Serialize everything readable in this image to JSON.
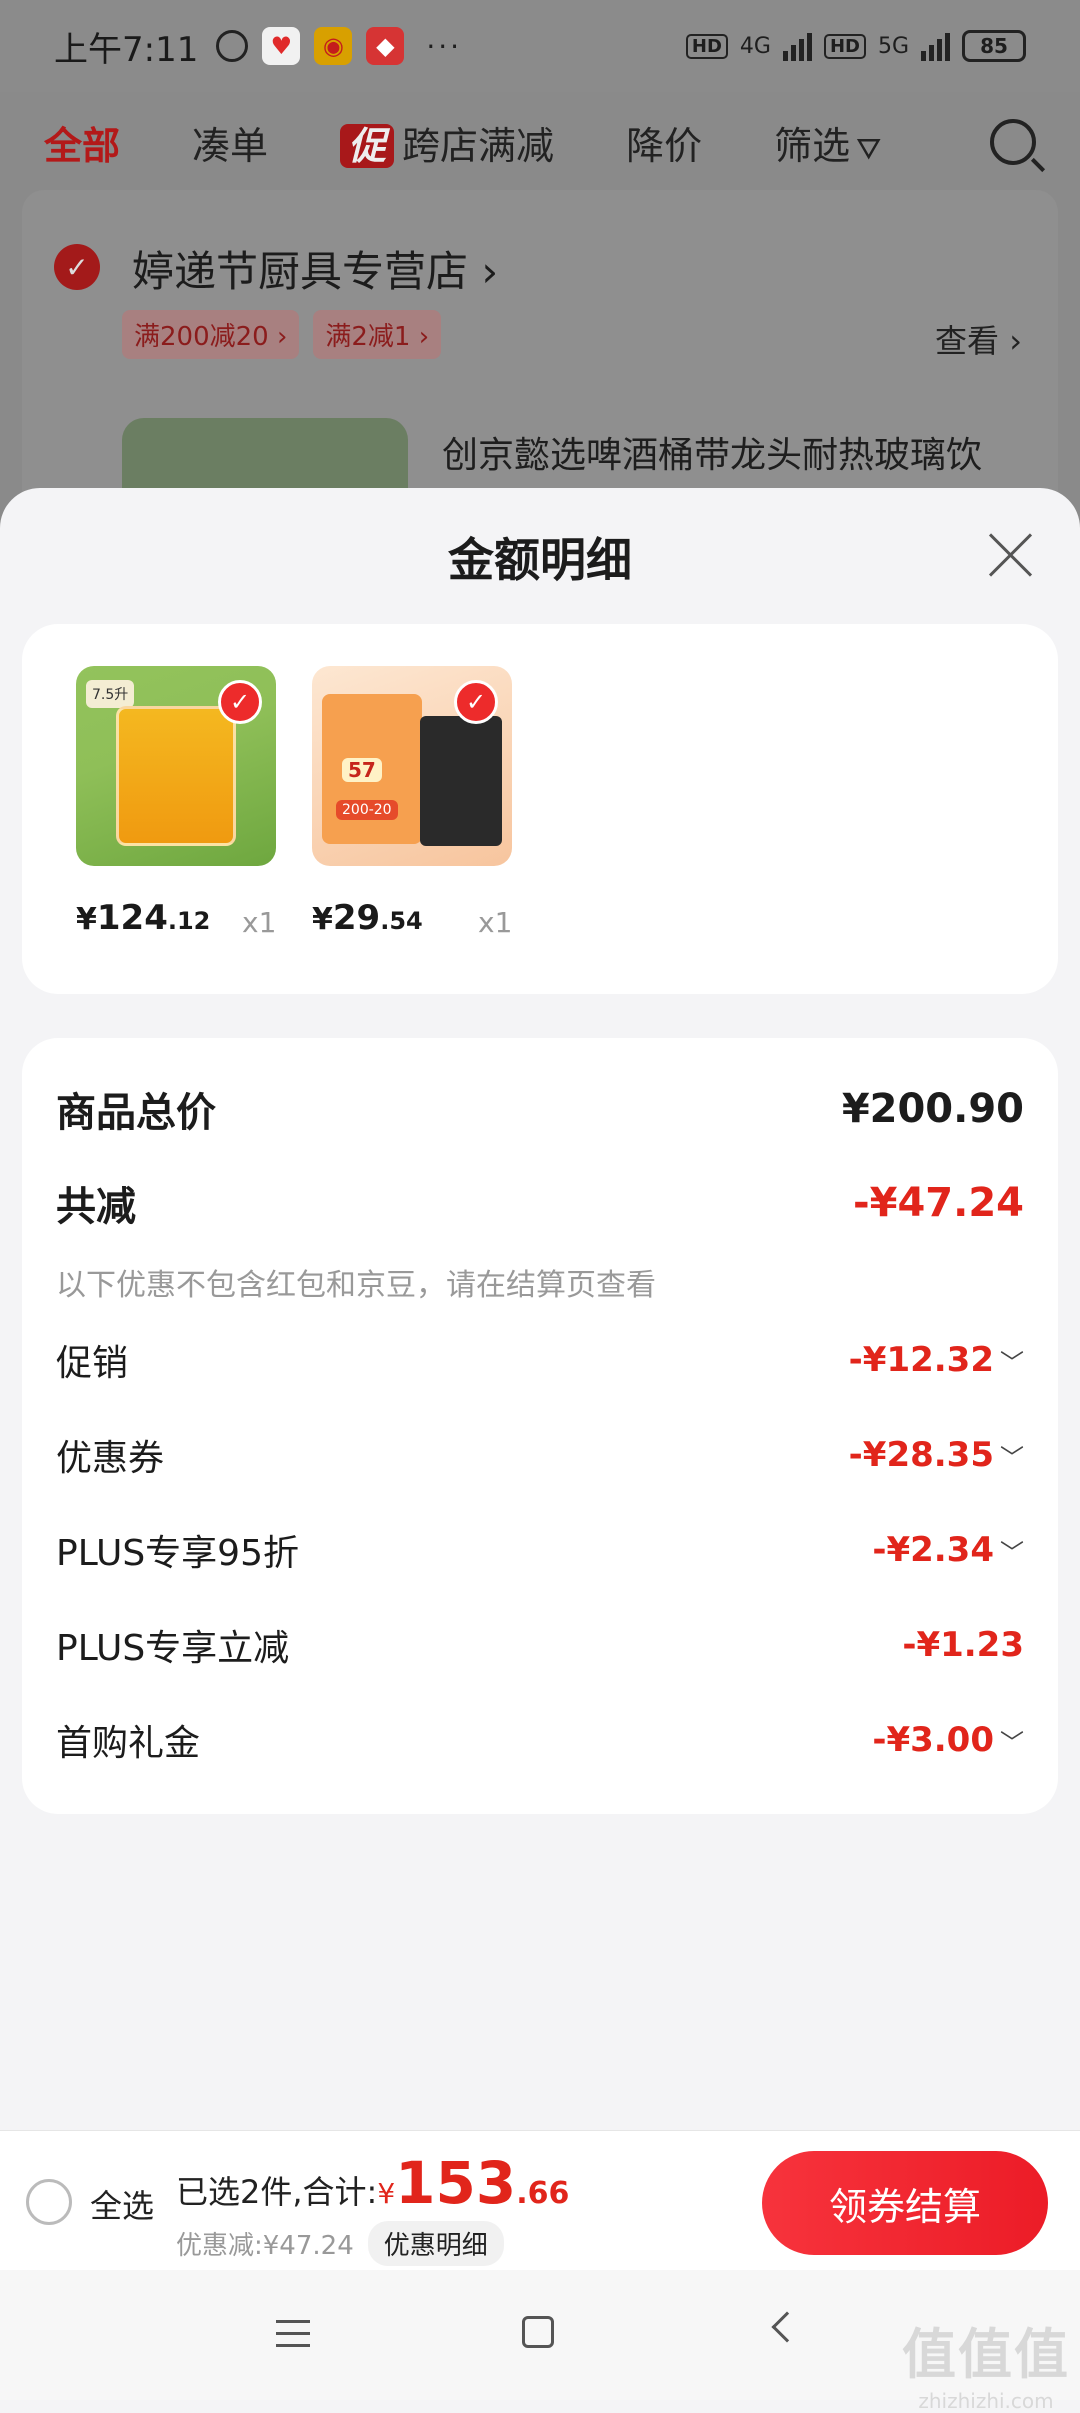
{
  "status_bar": {
    "time": "上午7:11",
    "network_tags": [
      "HD",
      "4G",
      "HD",
      "5G"
    ],
    "battery": "85",
    "more": "···"
  },
  "background_page": {
    "tabs": [
      {
        "label": "全部",
        "active": true
      },
      {
        "label": "凑单",
        "active": false
      },
      {
        "label": "跨店满减",
        "badge": "促",
        "active": false
      },
      {
        "label": "降价",
        "active": false
      },
      {
        "label": "筛选",
        "active": false
      }
    ],
    "store": {
      "name": "婷递节厨具专营店 ›",
      "tags": [
        "满200减20 ›",
        "满2减1 ›"
      ],
      "view_label": "查看 ›",
      "product_title": "创京懿选啤酒桶带龙头耐热玻璃饮"
    }
  },
  "sheet": {
    "title": "金额明细",
    "items": [
      {
        "price_symbol": "¥",
        "price_int": "124",
        "price_dec": ".12",
        "qty": "x1",
        "thumb_label": "7.5升"
      },
      {
        "price_symbol": "¥",
        "price_int": "29",
        "price_dec": ".54",
        "qty": "x1",
        "thumb_badge": "57",
        "thumb_ribbon": "200-20"
      }
    ],
    "summary": {
      "total_label": "商品总价",
      "total_value": "¥200.90",
      "reduce_label": "共减",
      "reduce_value": "-¥47.24",
      "note": "以下优惠不包含红包和京豆，请在结算页查看",
      "rows": [
        {
          "label": "促销",
          "value": "-¥12.32",
          "expandable": true
        },
        {
          "label": "优惠券",
          "value": "-¥28.35",
          "expandable": true
        },
        {
          "label": "PLUS专享95折",
          "value": "-¥2.34",
          "expandable": true
        },
        {
          "label": "PLUS专享立减",
          "value": "-¥1.23",
          "expandable": false
        },
        {
          "label": "首购礼金",
          "value": "-¥3.00",
          "expandable": true
        }
      ]
    }
  },
  "checkout": {
    "select_all": "全选",
    "selected_text": "已选2件,合计:",
    "currency": "¥",
    "total_int": "153",
    "total_dec": ".66",
    "discount_text": "优惠减:¥47.24",
    "detail_button": "优惠明细",
    "checkout_button": "领券结算"
  },
  "watermark": {
    "main": "值值值",
    "sub": "zhizhizhi.com"
  },
  "colors": {
    "accent": "#e1251b",
    "button": "#ec1c27"
  },
  "icons": [
    "alarm-icon",
    "health-app-icon",
    "weibo-app-icon",
    "jd-app-icon",
    "search-icon",
    "filter-icon",
    "close-icon",
    "check-icon",
    "chevron-down-icon",
    "menu-icon",
    "home-icon",
    "back-icon"
  ]
}
